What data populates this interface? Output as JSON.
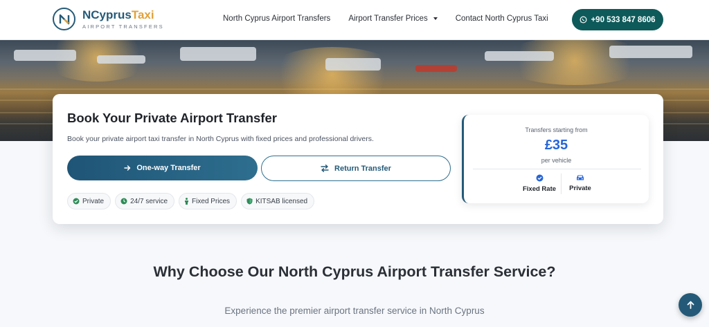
{
  "brand": {
    "name_part1": "NCyprus",
    "name_part2": "Taxi",
    "tagline": "AIRPORT TRANSFERS",
    "logo_icon": "n-logo-icon"
  },
  "nav": {
    "items": [
      {
        "label": "North Cyprus Airport Transfers"
      },
      {
        "label": "Airport Transfer Prices",
        "has_dropdown": true
      },
      {
        "label": "Contact North Cyprus Taxi"
      }
    ],
    "phone_label": "+90 533 847 8606",
    "phone_icon": "whatsapp-icon"
  },
  "booking": {
    "title": "Book Your Private Airport Transfer",
    "description": "Book your private airport taxi transfer in North Cyprus with fixed prices and professional drivers.",
    "oneway_label": "One-way Transfer",
    "oneway_icon": "arrow-right-icon",
    "return_label": "Return Transfer",
    "return_icon": "exchange-icon",
    "badges": [
      {
        "label": "Private",
        "icon": "check-circle-icon"
      },
      {
        "label": "24/7 service",
        "icon": "clock-icon"
      },
      {
        "label": "Fixed Prices",
        "icon": "person-icon"
      },
      {
        "label": "KITSAB licensed",
        "icon": "shield-icon"
      }
    ]
  },
  "price": {
    "from_label": "Transfers starting from",
    "amount": "£35",
    "per_label": "per vehicle",
    "features": [
      {
        "label": "Fixed Rate",
        "icon": "check-circle-icon"
      },
      {
        "label": "Private",
        "icon": "car-icon"
      }
    ]
  },
  "section": {
    "title": "Why Choose Our North Cyprus Airport Transfer Service?",
    "subtitle": "Experience the premier airport transfer service in North Cyprus"
  },
  "colors": {
    "primary": "#245a78",
    "accent": "#e0a13a",
    "whatsapp_button": "#0e5a5a",
    "price": "#2565d8"
  }
}
